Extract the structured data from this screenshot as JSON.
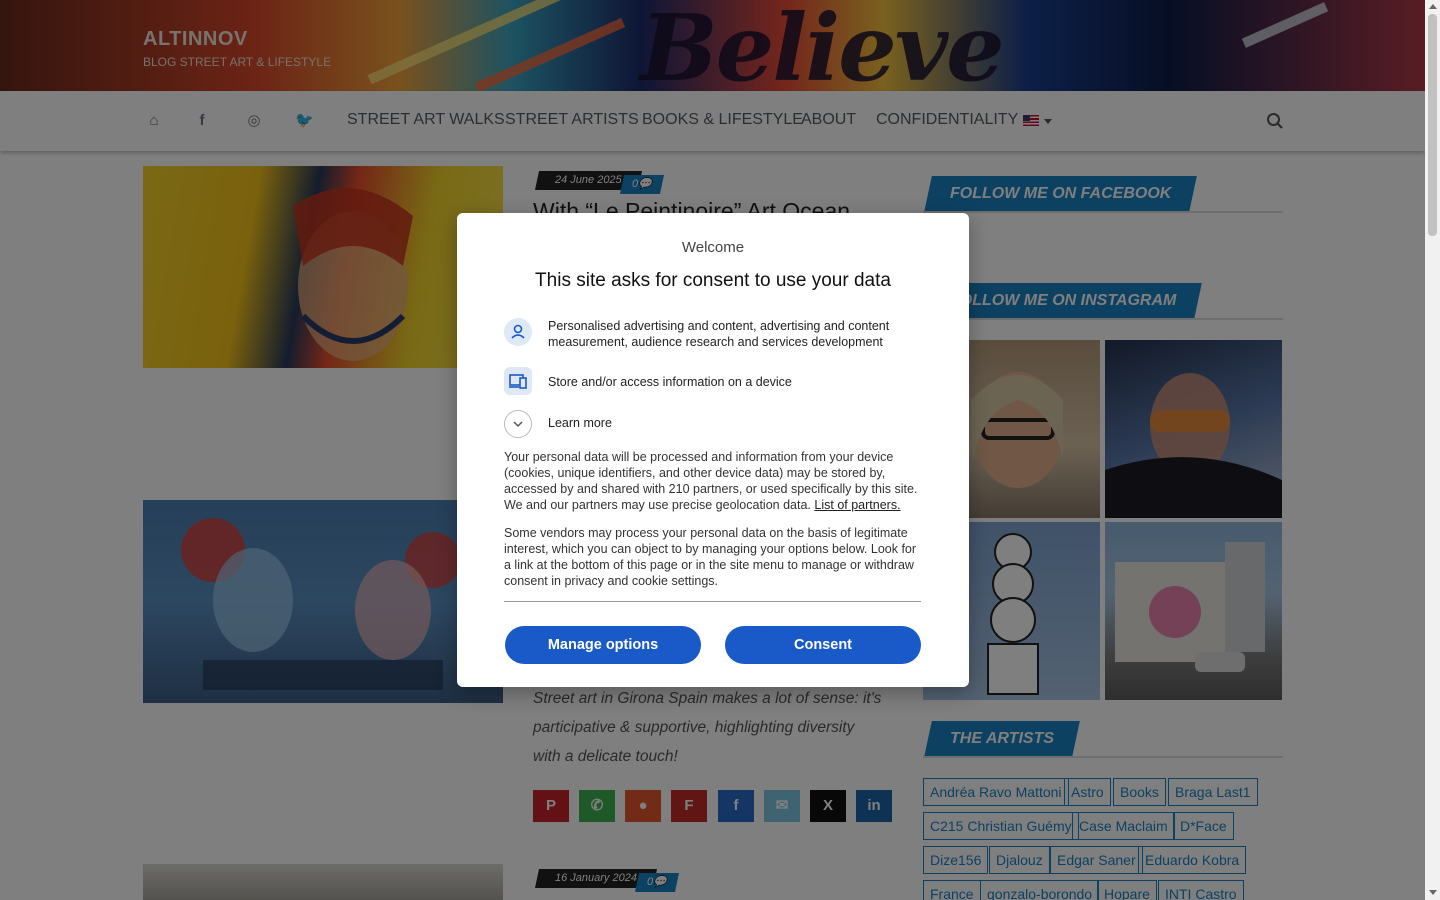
{
  "site": {
    "title": "ALTINNOV",
    "subtitle": "BLOG STREET ART & LIFESTYLE"
  },
  "nav": {
    "items": [
      "STREET ART WALKS",
      "STREET ARTISTS",
      "BOOKS & LIFESTYLE",
      "ABOUT",
      "CONFIDENTIALITY"
    ]
  },
  "posts": [
    {
      "date": "24 June 2025",
      "comments": "0",
      "title": "With “Le Peintinoire” Art Ocean"
    },
    {
      "excerpt": "Street art in Girona Spain makes a lot of sense: it's participative & supportive, highlighting diversity with a delicate touch!"
    },
    {
      "date": "16 January 2024",
      "comments": "0"
    }
  ],
  "sidebar": {
    "facebook_title": "FOLLOW ME ON FACEBOOK",
    "instagram_title": "FOLLOW ME ON INSTAGRAM",
    "artists_title": "THE ARTISTS",
    "tags": [
      "Andréa Ravo Mattoni",
      "Astro",
      "Books",
      "Braga Last1",
      "C215 Christian Guémy",
      "Case Maclaim",
      "D*Face",
      "Dize156",
      "Djalouz",
      "Edgar Saner",
      "Eduardo Kobra",
      "France",
      "gonzalo-borondo",
      "Hopare",
      "INTI Castro"
    ]
  },
  "modal": {
    "welcome": "Welcome",
    "title": "This site asks for consent to use your data",
    "purpose_1": "Personalised advertising and content, advertising and content measurement, audience research and services development",
    "purpose_2": "Store and/or access information on a device",
    "learn_more": "Learn more",
    "para_1": "Your personal data will be processed and information from your device (cookies, unique identifiers, and other device data) may be stored by, accessed by and shared with 210 partners, or used specifically by this site. We and our partners may use precise geolocation data.",
    "partners_link": "List of partners.",
    "para_2": "Some vendors may process your personal data on the basis of legitimate interest, which you can object to by managing your options below. Look for a link at the bottom of this page or in the site menu to manage or withdraw consent in privacy and cookie settings.",
    "manage_button": "Manage options",
    "consent_button": "Consent"
  },
  "colors": {
    "accent": "#1b82c5",
    "consent_blue": "#1a5ac8"
  }
}
